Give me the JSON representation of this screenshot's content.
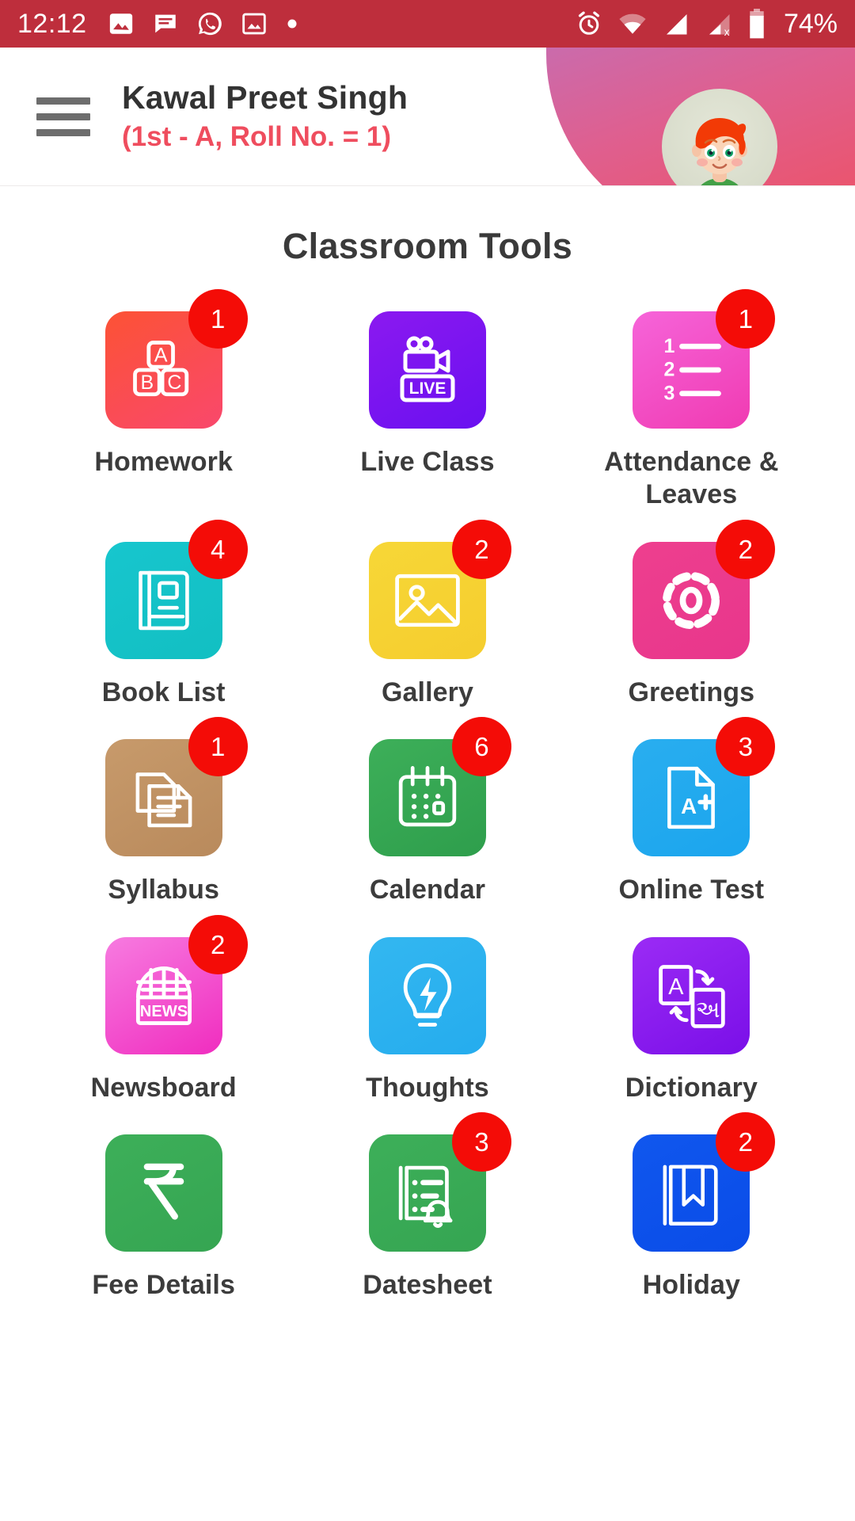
{
  "status_bar": {
    "time": "12:12",
    "battery_percent": "74%",
    "left_icons": [
      "photos-icon",
      "message-icon",
      "whatsapp-icon",
      "image-icon",
      "dot-icon"
    ],
    "right_icons": [
      "alarm-icon",
      "wifi-icon",
      "signal-icon",
      "signal-no-sim-icon",
      "battery-icon"
    ],
    "background_color": "#BE2E3C"
  },
  "header": {
    "menu_icon": "hamburger-icon",
    "student_name": "Kawal Preet Singh",
    "student_details": "(1st - A, Roll No. = 1)",
    "avatar_icon": "student-avatar",
    "name_color": "#333333",
    "details_color": "#EF4D5E"
  },
  "main": {
    "title": "Classroom Tools",
    "tools": [
      {
        "label": "Homework",
        "icon": "abc-blocks-icon",
        "badge": "1",
        "color_from": "#FC5235",
        "color_to": "#F9486C"
      },
      {
        "label": "Live Class",
        "icon": "live-video-icon",
        "badge": "",
        "color_from": "#8B19F0",
        "color_to": "#6A10F0"
      },
      {
        "label": "Attendance & Leaves",
        "icon": "numbered-list-icon",
        "badge": "1",
        "color_from": "#F664D9",
        "color_to": "#F03BB2"
      },
      {
        "label": "Book List",
        "icon": "book-icon",
        "badge": "4",
        "color_from": "#17C6CE",
        "color_to": "#12BFC2"
      },
      {
        "label": "Gallery",
        "icon": "image-gallery-icon",
        "badge": "2",
        "color_from": "#F7D737",
        "color_to": "#F5CD2E"
      },
      {
        "label": "Greetings",
        "icon": "dashed-ring-icon",
        "badge": "2",
        "color_from": "#EE3F8E",
        "color_to": "#E8368C"
      },
      {
        "label": "Syllabus",
        "icon": "documents-icon",
        "badge": "1",
        "color_from": "#C79A6B",
        "color_to": "#B98A5C"
      },
      {
        "label": "Calendar",
        "icon": "calendar-icon",
        "badge": "6",
        "color_from": "#3DAF59",
        "color_to": "#2E9E4C"
      },
      {
        "label": "Online Test",
        "icon": "a-plus-document-icon",
        "badge": "3",
        "color_from": "#29AEEF",
        "color_to": "#1BA5EE"
      },
      {
        "label": "Newsboard",
        "icon": "news-kiosk-icon",
        "badge": "2",
        "color_from": "#F77BE0",
        "color_to": "#F02DBF"
      },
      {
        "label": "Thoughts",
        "icon": "lightbulb-icon",
        "badge": "",
        "color_from": "#33B7F0",
        "color_to": "#25ACEE"
      },
      {
        "label": "Dictionary",
        "icon": "translate-icon",
        "badge": "",
        "color_from": "#9B2BF5",
        "color_to": "#7A0FE8"
      },
      {
        "label": "Fee Details",
        "icon": "rupee-icon",
        "badge": "",
        "color_from": "#3DAF59",
        "color_to": "#35A552"
      },
      {
        "label": "Datesheet",
        "icon": "list-bell-icon",
        "badge": "3",
        "color_from": "#3DAF59",
        "color_to": "#35A552"
      },
      {
        "label": "Holiday",
        "icon": "bookmark-book-icon",
        "badge": "2",
        "color_from": "#1057EE",
        "color_to": "#0A4CE8"
      }
    ],
    "badge_color": "#F40C07",
    "title_color": "#3A3A3A"
  }
}
